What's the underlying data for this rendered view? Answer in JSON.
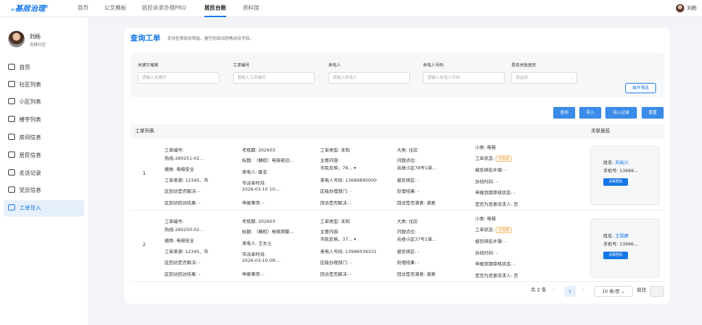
{
  "app": {
    "logo_prefix": "AI",
    "logo": "基层治理",
    "logo_sup": "®"
  },
  "nav": [
    "首页",
    "公文模板",
    "居民诉求办理PRO",
    "居民台账",
    "资料馆"
  ],
  "user": {
    "name": "刘杨",
    "org": "兆維社区"
  },
  "menu": [
    "首页",
    "社区列表",
    "小区列表",
    "楼宇列表",
    "房间信息",
    "居民信息",
    "走访记录",
    "党员信息",
    "工单导入"
  ],
  "page": {
    "title": "查询工单",
    "subtitle": "支持任意组合筛选，留空则自动忽略对应字段。"
  },
  "filters": [
    {
      "label": "关键字搜索",
      "placeholder": "请输入关键字"
    },
    {
      "label": "工单编号",
      "placeholder": "请输入工单编号"
    },
    {
      "label": "来电人",
      "placeholder": "请输入来电人"
    },
    {
      "label": "来电人号码",
      "placeholder": "请输入来电人号码"
    },
    {
      "label": "是否关联居民",
      "placeholder": "请选择",
      "dropdown": "⌄"
    }
  ],
  "expand_label": "展开筛选",
  "buttons": [
    "查询",
    "导入",
    "导入记录",
    "重置"
  ],
  "list": {
    "title": "工单列表",
    "related": "关联居民"
  },
  "rows": [
    {
      "no": "1",
      "c1": [
        "工单编号:",
        "热线-260251-02...",
        "细类:  电梯安全",
        "工单来源:  12345、市",
        "区回访是否解决:  -",
        "区回访回访结果:  -"
      ],
      "c2": [
        "考核期:  202603",
        "标题:  （横权）电梯老旧...",
        "来电人:  匿名",
        "市派单时间:",
        "2026-03-10 10:...",
        "申报事项:  -"
      ],
      "c3": [
        "工单类型:  未知",
        "主要内容:",
        "市民反映，78...  ▾",
        "来电人号码:  13689890000",
        "区级办理部门:  -",
        "回访是否解决:  -"
      ],
      "c4": [
        "大类:  住房",
        "问题点位:",
        "兆维小区78号1单...",
        "被反映区:  -",
        "处理结果:  -",
        "回访是否满意:  满意"
      ],
      "c5": [
        "小类:  电梯",
        "工单状态:",
        "被反映街乡镇:  -",
        "办结时间:  -",
        "申报到期审核状态:  -",
        "是否为恶意诉求人:  否"
      ],
      "status": "已完成",
      "resident": {
        "name_label": "姓名:",
        "name": "刘高兴",
        "phone": "手机号:  13689...",
        "btn": "关联居民"
      }
    },
    {
      "no": "2",
      "c1": [
        "工单编号:",
        "热线-260250-02...",
        "细类:  电梯安全",
        "工单来源:  12345、市",
        "区回访是否解决:  -",
        "区回访回访结果:  -"
      ],
      "c2": [
        "考核期:  202603",
        "标题:  （横权）电梯频繁...",
        "来电人:  王女士",
        "市派单时间:",
        "2026-03-10 09:...",
        "申报事项:  -"
      ],
      "c3": [
        "工单类型:  未知",
        "主要内容:",
        "市民反映，37...  ▾",
        "来电人号码:  13996039331",
        "区级办理部门:  -",
        "回访是否解决:  -"
      ],
      "c4": [
        "大类:  住房",
        "问题点位:",
        "兆维小区37号1单...",
        "被反映区:  -",
        "处理结果:  -",
        "回访是否满意:  满意"
      ],
      "c5": [
        "小类:  电梯",
        "工单状态:",
        "被反映街乡镇:  -",
        "办结时间:  -",
        "申报到期审核状态:  -",
        "是否为恶意诉求人:  否"
      ],
      "status": "已完成",
      "resident": {
        "name_label": "姓名:",
        "name": "王慧娜",
        "phone": "手机号:  13996...",
        "btn": "关联居民"
      }
    }
  ],
  "pagination": {
    "total": "共 2 条",
    "prev": "‹",
    "page": "1",
    "next": "›",
    "size": "10 条/页  ⌄",
    "goto": "前往"
  },
  "colors": {
    "accent": "#1677e6",
    "status": "#e8902a"
  }
}
